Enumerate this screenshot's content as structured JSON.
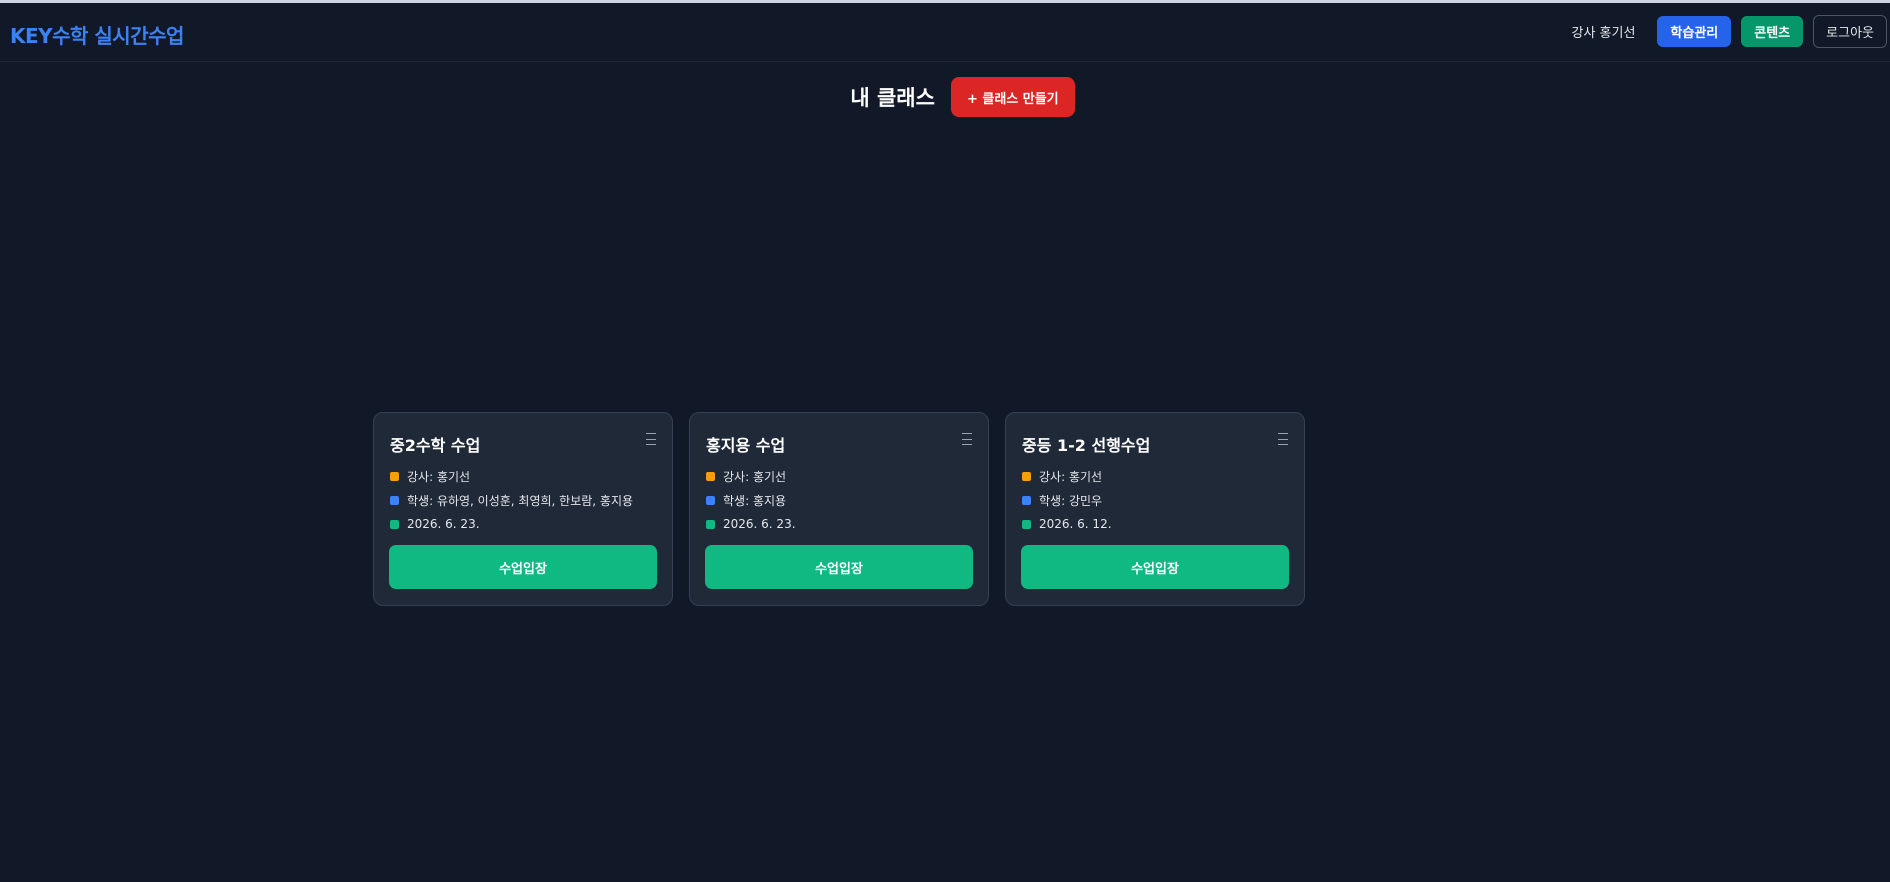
{
  "header": {
    "brand": "KEY수학 실시간수업",
    "teacher_label": "강사 홍기선",
    "nav_learning": "학습관리",
    "nav_contents": "콘텐츠",
    "nav_logout": "로그아웃"
  },
  "page": {
    "title": "내 클래스",
    "create_button": "+ 클래스 만들기"
  },
  "colors": {
    "background": "#111827",
    "brand": "#3b82f6",
    "teacher_dot": "#f59e0b",
    "student_dot": "#3b82f6",
    "date_dot": "#10b981",
    "enter_button": "#10b981",
    "create_button": "#dc2626"
  },
  "icons": {
    "card_menu": "menu-icon"
  },
  "classes": [
    {
      "title": "중2수학 수업",
      "teacher": "강사: 홍기선",
      "students": "학생: 유하영, 이성훈, 최영희, 한보람, 홍지용",
      "date": "2026. 6. 23.",
      "enter_label": "수업입장"
    },
    {
      "title": "홍지용 수업",
      "teacher": "강사: 홍기선",
      "students": "학생: 홍지용",
      "date": "2026. 6. 23.",
      "enter_label": "수업입장"
    },
    {
      "title": "중등 1-2 선행수업",
      "teacher": "강사: 홍기선",
      "students": "학생: 강민우",
      "date": "2026. 6. 12.",
      "enter_label": "수업입장"
    }
  ]
}
